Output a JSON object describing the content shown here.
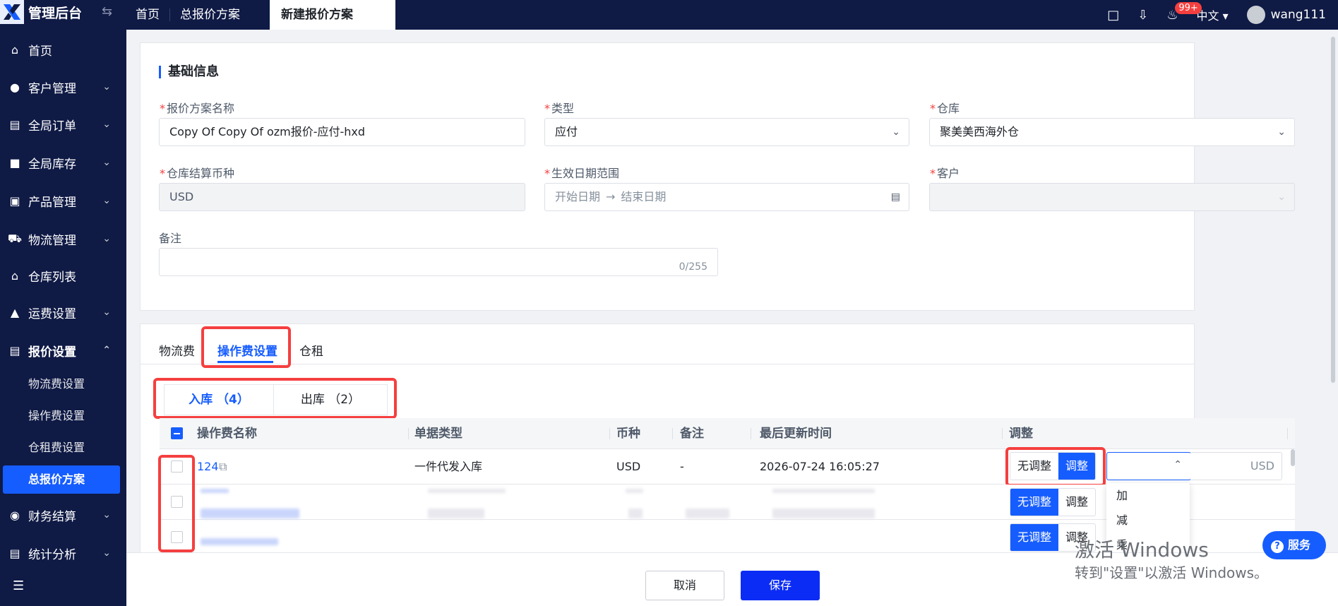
{
  "topbar": {
    "app_title": "管理后台",
    "tabs": [
      "首页",
      "总报价方案",
      "新建报价方案"
    ],
    "notification_count": "99+",
    "language": "中文",
    "username": "wang111"
  },
  "sidebar": {
    "items": [
      {
        "label": "首页",
        "icon": "home-icon"
      },
      {
        "label": "客户管理",
        "icon": "users-icon"
      },
      {
        "label": "全局订单",
        "icon": "order-icon"
      },
      {
        "label": "全局库存",
        "icon": "inventory-icon"
      },
      {
        "label": "产品管理",
        "icon": "product-icon"
      },
      {
        "label": "物流管理",
        "icon": "truck-icon"
      },
      {
        "label": "仓库列表",
        "icon": "warehouse-icon"
      },
      {
        "label": "运费设置",
        "icon": "freight-icon"
      },
      {
        "label": "报价设置",
        "icon": "quote-icon"
      },
      {
        "label": "财务结算",
        "icon": "finance-icon"
      },
      {
        "label": "统计分析",
        "icon": "chart-icon"
      }
    ],
    "sub_items": [
      "物流费设置",
      "操作费设置",
      "仓租费设置",
      "总报价方案"
    ]
  },
  "basic": {
    "title": "基础信息",
    "name_label": "报价方案名称",
    "name_value": "Copy Of Copy Of ozm报价-应付-hxd",
    "type_label": "类型",
    "type_value": "应付",
    "warehouse_label": "仓库",
    "warehouse_value": "聚美美西海外仓",
    "currency_label": "仓库结算币种",
    "currency_value": "USD",
    "date_label": "生效日期范围",
    "date_start": "开始日期",
    "date_arrow": "→",
    "date_end": "结束日期",
    "customer_label": "客户",
    "remark_label": "备注",
    "remark_counter": "0/255"
  },
  "fee_tabs": [
    "物流费",
    "操作费设置",
    "仓租"
  ],
  "segments": [
    "入库 （4）",
    "出库 （2）"
  ],
  "table": {
    "headers": [
      "操作费名称",
      "单据类型",
      "币种",
      "备注",
      "最后更新时间",
      "调整"
    ],
    "row1": {
      "name": "124",
      "doc_type": "一件代发入库",
      "currency": "USD",
      "remark": "-",
      "updated": "2026-07-24 16:05:27"
    },
    "no_adjust": "无调整",
    "adjust": "调整",
    "unit": "USD",
    "adjust_options": [
      "加",
      "减",
      "乘"
    ]
  },
  "footer": {
    "cancel": "取消",
    "save": "保存"
  },
  "help_label": "服务",
  "windows_activation": {
    "line1": "激活 Windows",
    "line2": "转到\"设置\"以激活 Windows。"
  }
}
